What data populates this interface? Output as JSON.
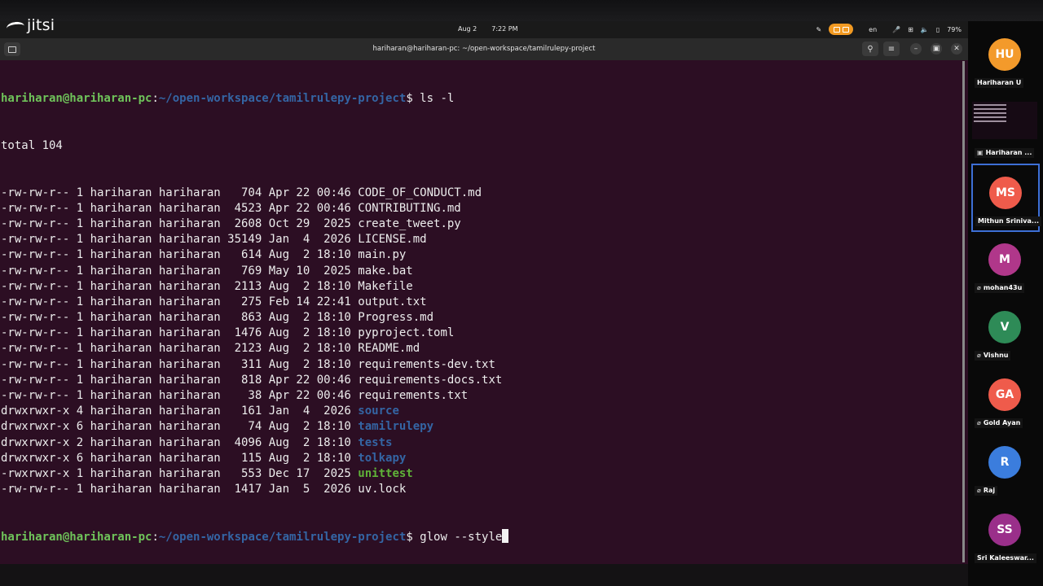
{
  "overlay": {
    "brand": "jitsi"
  },
  "topbar": {
    "date": "Aug 2",
    "time": "7:22 PM",
    "lang": "en",
    "battery": "79%"
  },
  "window": {
    "title": "hariharan@hariharan-pc: ~/open-workspace/tamilrulepy-project"
  },
  "terminal": {
    "prompt_user": "hariharan@hariharan-pc",
    "prompt_path": "~/open-workspace/tamilrulepy-project",
    "cmd1": "ls -l",
    "total": "total 104",
    "cmd2": "glow --style",
    "rows": [
      {
        "meta": "-rw-rw-r-- 1 hariharan hariharan   704 Apr 22 00:46 ",
        "name": "CODE_OF_CONDUCT.md",
        "kind": "file"
      },
      {
        "meta": "-rw-rw-r-- 1 hariharan hariharan  4523 Apr 22 00:46 ",
        "name": "CONTRIBUTING.md",
        "kind": "file"
      },
      {
        "meta": "-rw-rw-r-- 1 hariharan hariharan  2608 Oct 29  2025 ",
        "name": "create_tweet.py",
        "kind": "file"
      },
      {
        "meta": "-rw-rw-r-- 1 hariharan hariharan 35149 Jan  4  2026 ",
        "name": "LICENSE.md",
        "kind": "file"
      },
      {
        "meta": "-rw-rw-r-- 1 hariharan hariharan   614 Aug  2 18:10 ",
        "name": "main.py",
        "kind": "file"
      },
      {
        "meta": "-rw-rw-r-- 1 hariharan hariharan   769 May 10  2025 ",
        "name": "make.bat",
        "kind": "file"
      },
      {
        "meta": "-rw-rw-r-- 1 hariharan hariharan  2113 Aug  2 18:10 ",
        "name": "Makefile",
        "kind": "file"
      },
      {
        "meta": "-rw-rw-r-- 1 hariharan hariharan   275 Feb 14 22:41 ",
        "name": "output.txt",
        "kind": "file"
      },
      {
        "meta": "-rw-rw-r-- 1 hariharan hariharan   863 Aug  2 18:10 ",
        "name": "Progress.md",
        "kind": "file"
      },
      {
        "meta": "-rw-rw-r-- 1 hariharan hariharan  1476 Aug  2 18:10 ",
        "name": "pyproject.toml",
        "kind": "file"
      },
      {
        "meta": "-rw-rw-r-- 1 hariharan hariharan  2123 Aug  2 18:10 ",
        "name": "README.md",
        "kind": "file"
      },
      {
        "meta": "-rw-rw-r-- 1 hariharan hariharan   311 Aug  2 18:10 ",
        "name": "requirements-dev.txt",
        "kind": "file"
      },
      {
        "meta": "-rw-rw-r-- 1 hariharan hariharan   818 Apr 22 00:46 ",
        "name": "requirements-docs.txt",
        "kind": "file"
      },
      {
        "meta": "-rw-rw-r-- 1 hariharan hariharan    38 Apr 22 00:46 ",
        "name": "requirements.txt",
        "kind": "file"
      },
      {
        "meta": "drwxrwxr-x 4 hariharan hariharan   161 Jan  4  2026 ",
        "name": "source",
        "kind": "dir"
      },
      {
        "meta": "drwxrwxr-x 6 hariharan hariharan    74 Aug  2 18:10 ",
        "name": "tamilrulepy",
        "kind": "dir"
      },
      {
        "meta": "drwxrwxr-x 2 hariharan hariharan  4096 Aug  2 18:10 ",
        "name": "tests",
        "kind": "dir"
      },
      {
        "meta": "drwxrwxr-x 6 hariharan hariharan   115 Aug  2 18:10 ",
        "name": "tolkapy",
        "kind": "dir"
      },
      {
        "meta": "-rwxrwxr-x 1 hariharan hariharan   553 Dec 17  2025 ",
        "name": "unittest",
        "kind": "exe"
      },
      {
        "meta": "-rw-rw-r-- 1 hariharan hariharan  1417 Jan  5  2026 ",
        "name": "uv.lock",
        "kind": "file"
      }
    ]
  },
  "participants": [
    {
      "initials": "HU",
      "name": "Hariharan U",
      "color": "#f39a2b",
      "muted": false
    },
    {
      "initials": "",
      "name": "Hariharan ...",
      "color": "",
      "muted": false,
      "screen": true
    },
    {
      "initials": "MS",
      "name": "Mithun Sriniva...",
      "color": "#ef5b4b",
      "muted": false,
      "active": true
    },
    {
      "initials": "M",
      "name": "mohan43u",
      "color": "#b0378a",
      "muted": true
    },
    {
      "initials": "V",
      "name": "Vishnu",
      "color": "#2e8b57",
      "muted": true
    },
    {
      "initials": "GA",
      "name": "Gold Ayan",
      "color": "#ef5b4b",
      "muted": true
    },
    {
      "initials": "R",
      "name": "Raj",
      "color": "#3b7ddd",
      "muted": true
    },
    {
      "initials": "SS",
      "name": "Sri Kaleeswar...",
      "color": "#9a2f8a",
      "muted": false
    }
  ]
}
